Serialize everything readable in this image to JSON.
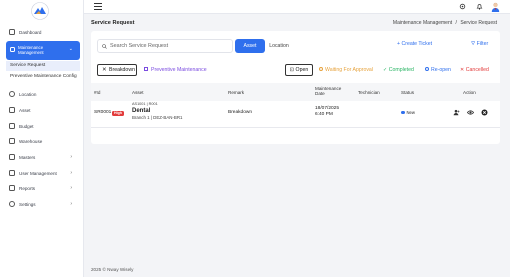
{
  "sidebar": {
    "items": [
      {
        "label": "Dashboard",
        "icon": "dashboard-icon"
      },
      {
        "label": "Maintenance Management",
        "icon": "wrench-icon",
        "active": true
      },
      {
        "label": "Service Request"
      },
      {
        "label": "Preventive Maintenance Config"
      },
      {
        "label": "Location",
        "icon": "location-icon"
      },
      {
        "label": "Asset",
        "icon": "asset-icon"
      },
      {
        "label": "Budget",
        "icon": "budget-icon"
      },
      {
        "label": "Warehouse",
        "icon": "warehouse-icon"
      },
      {
        "label": "Masters",
        "icon": "masters-icon"
      },
      {
        "label": "User Management",
        "icon": "users-icon"
      },
      {
        "label": "Reports",
        "icon": "reports-icon"
      },
      {
        "label": "Settings",
        "icon": "settings-icon"
      }
    ]
  },
  "header": {
    "title": "Service Request",
    "breadcrumb": [
      "Maintenance Management",
      "Service Request"
    ],
    "breadcrumb_sep": "/"
  },
  "toolbar": {
    "search_placeholder": "Search Service Request",
    "asset_label": "Asset",
    "location_label": "Location",
    "create_label": "+ Create Ticket",
    "filter_label": "Filter"
  },
  "filters": {
    "breakdown_label": "Breakdown",
    "preventive_label": "Preventive Maintenance",
    "open_label": "Open",
    "waiting_label": "Waiting For Approval",
    "completed_label": "Completed",
    "reopen_label": "Re-open",
    "cancelled_label": "Cancelled"
  },
  "table": {
    "columns": [
      "#Id",
      "Asset",
      "Remark",
      "Maintenance Date",
      "Technician",
      "Status",
      "Action"
    ],
    "rows": [
      {
        "id": "SR0001",
        "priority": "High",
        "asset_code": "AS1001 | R001",
        "asset_name": "Dental",
        "asset_location": "Branch 1 | DEZ-BAN-BR1",
        "remark": "Breakdown",
        "date": "18/07/2025 6:40 PM",
        "technician": "",
        "status": "New"
      }
    ]
  },
  "footer": {
    "copyright": "2025 © Nway Wisely"
  },
  "colors": {
    "primary": "#2f6fed",
    "purple": "#7b4ce0",
    "waiting": "#e6a23c",
    "completed": "#28b463",
    "reopen": "#2f6fed",
    "cancelled": "#e23b3b",
    "high": "#e23b3b"
  }
}
